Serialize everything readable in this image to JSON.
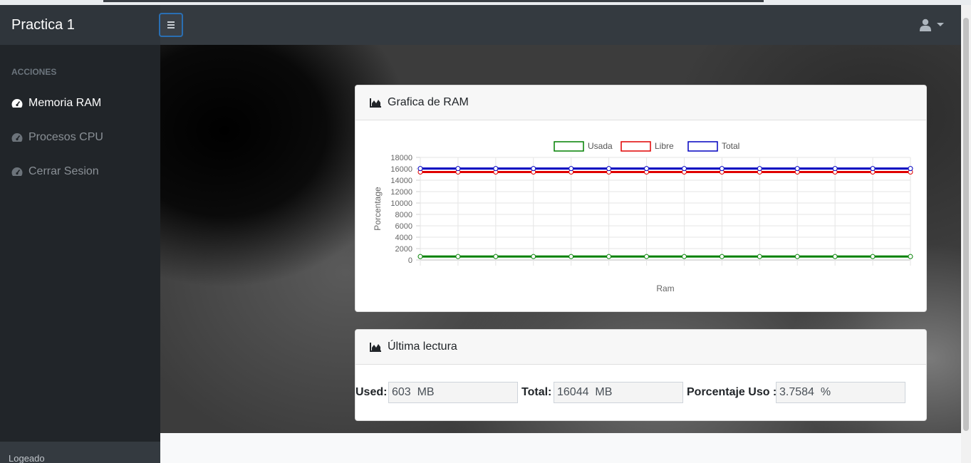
{
  "navbar": {
    "brand": "Practica 1",
    "toggle_icon": "menu-icon",
    "user_icon": "user-icon"
  },
  "sidebar": {
    "heading": "ACCIONES",
    "items": [
      {
        "label": "Memoria RAM",
        "icon": "dashboard-icon",
        "active": true
      },
      {
        "label": "Procesos CPU",
        "icon": "dashboard-icon",
        "active": false
      },
      {
        "label": "Cerrar Sesion",
        "icon": "dashboard-icon",
        "active": false
      }
    ],
    "footer": "Logeado"
  },
  "ram_card": {
    "title": "Grafica de RAM",
    "icon": "area-chart-icon"
  },
  "reading_card": {
    "title": "Última lectura",
    "icon": "area-chart-icon",
    "used_label": "Used:",
    "used_value": "603  MB",
    "total_label": "Total:",
    "total_value": "16044  MB",
    "percent_label": "Porcentaje Uso :",
    "percent_value": "3.7584  %"
  },
  "chart_data": {
    "type": "line",
    "title": "",
    "xlabel": "Ram",
    "ylabel": "Porcentage",
    "ylim": [
      0,
      18000
    ],
    "yticks": [
      0,
      2000,
      4000,
      6000,
      8000,
      10000,
      12000,
      14000,
      16000,
      18000
    ],
    "x_points": 14,
    "grid": true,
    "legend_position": "top",
    "series": [
      {
        "name": "Usada",
        "color": "#008000",
        "values": [
          603,
          603,
          603,
          603,
          603,
          603,
          603,
          603,
          603,
          603,
          603,
          603,
          603,
          603
        ]
      },
      {
        "name": "Libre",
        "color": "#e00000",
        "values": [
          15441,
          15441,
          15441,
          15441,
          15441,
          15441,
          15441,
          15441,
          15441,
          15441,
          15441,
          15441,
          15441,
          15441
        ]
      },
      {
        "name": "Total",
        "color": "#0000c0",
        "values": [
          16044,
          16044,
          16044,
          16044,
          16044,
          16044,
          16044,
          16044,
          16044,
          16044,
          16044,
          16044,
          16044,
          16044
        ]
      }
    ]
  }
}
